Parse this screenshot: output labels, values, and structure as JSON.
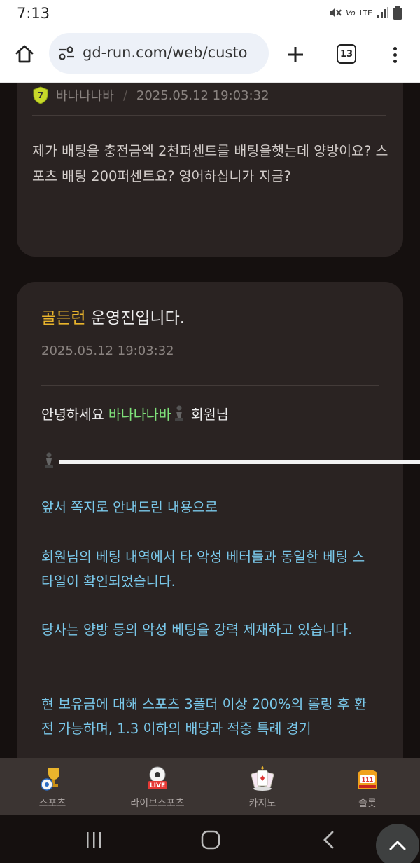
{
  "status": {
    "time": "7:13",
    "network": "LTE"
  },
  "browser": {
    "url": "gd-run.com/web/custo",
    "tab_count": "13"
  },
  "question": {
    "username": "바나나나바",
    "separator": "/",
    "datetime": "2025.05.12 19:03:32",
    "body": "제가 배팅을 충전금엑 2천퍼센트를 배팅을햇는데 양방이요? 스포츠 배팅 200퍼센트요? 영어하십니가 지금?"
  },
  "answer": {
    "brand": "골든런",
    "title_rest": " 운영진입니다.",
    "datetime": "2025.05.12 19:03:32",
    "greeting_prefix": "안녕하세요 ",
    "greeting_name": "바나나나바",
    "greeting_suffix": " 회원님",
    "paragraphs": [
      "앞서 쪽지로 안내드린 내용으로",
      "회원님의 베팅 내역에서 타 악성 베터들과 동일한 베팅 스타일이 확인되었습니다.",
      "당사는 양방 등의 악성 베팅을 강력 제재하고 있습니다.",
      "현 보유금에 대해 스포츠 3폴더 이상 200%의 롤링 후 환전 가능하며, 1.3 이하의 배당과 적중 특례 경기"
    ]
  },
  "bottom_nav": [
    {
      "label": "스포츠",
      "icon": "sports-trophy-icon"
    },
    {
      "label": "라이브스포츠",
      "icon": "live-ball-icon"
    },
    {
      "label": "카지노",
      "icon": "casino-cards-icon"
    },
    {
      "label": "슬롯",
      "icon": "slot-machine-icon"
    }
  ],
  "colors": {
    "brand_gold": "#e9b42c",
    "name_green": "#7fe17a",
    "answer_blue": "#7ac8ea",
    "card_bg": "#2a2322",
    "page_bg": "#15100f"
  }
}
